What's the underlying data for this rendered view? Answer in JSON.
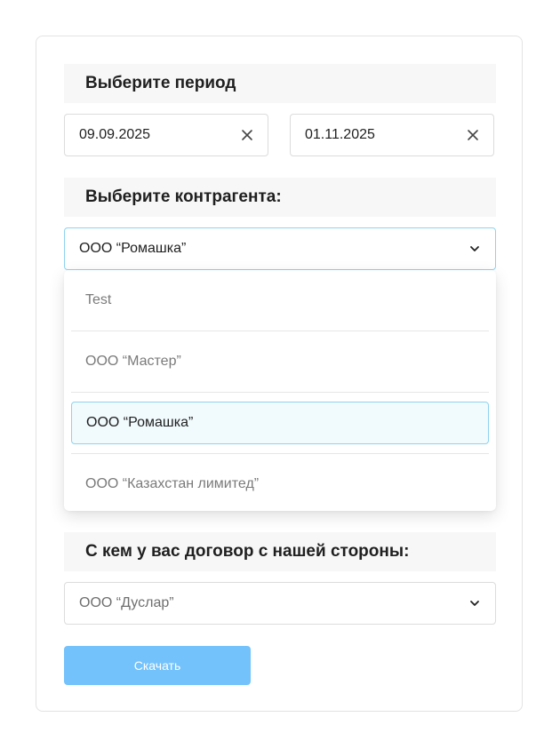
{
  "period": {
    "title": "Выберите период",
    "date_from": "09.09.2025",
    "date_to": "01.11.2025"
  },
  "counterparty": {
    "title": "Выберите контрагента:",
    "selected": "ООО “Ромашка”",
    "options": [
      "Test",
      "ООО “Мастер”",
      "ООО “Ромашка”",
      "ООО “Казахстан лимитед”"
    ]
  },
  "contract": {
    "title": "С кем у вас договор с нашей стороны:",
    "selected": "ООО “Дуслар”"
  },
  "actions": {
    "download_label": "Скачать"
  },
  "icons": {
    "clear": "close-icon",
    "dropdown": "chevron-down-icon"
  },
  "colors": {
    "accent_border": "#8ed3ef",
    "button_bg": "#73c2fb",
    "selected_option_bg": "#f1fafd"
  }
}
